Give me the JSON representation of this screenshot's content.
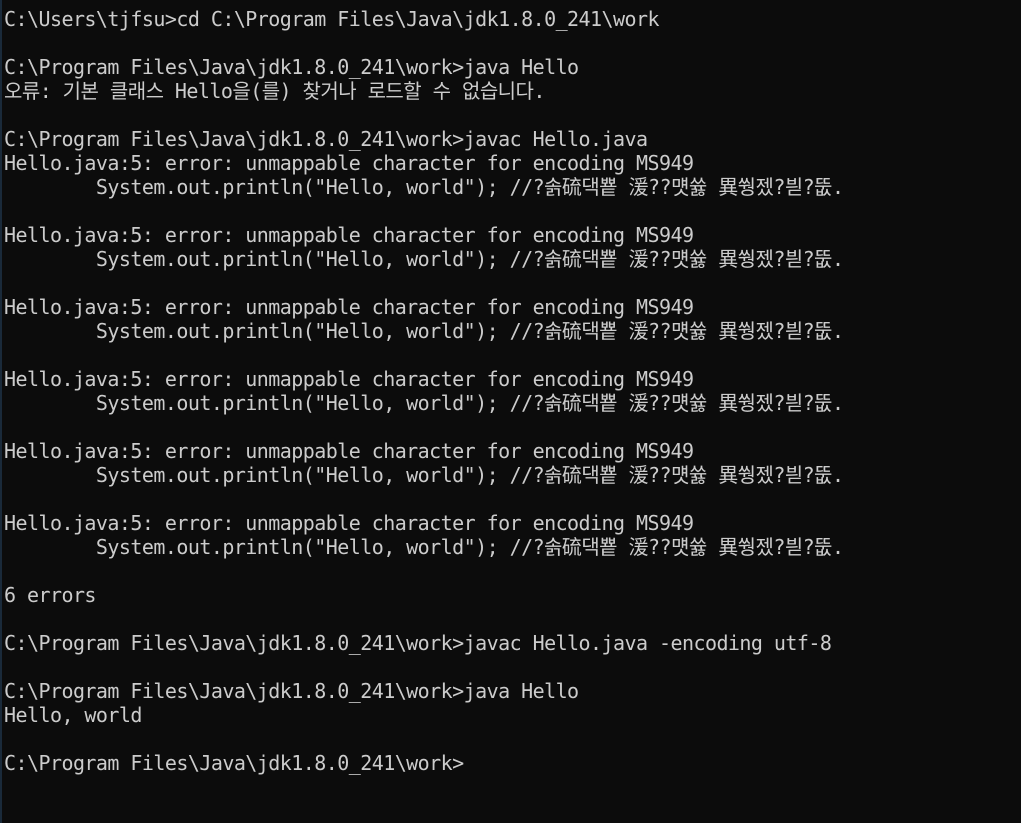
{
  "console": {
    "lines": [
      "C:\\Users\\tjfsu>cd C:\\Program Files\\Java\\jdk1.8.0_241\\work",
      "",
      "C:\\Program Files\\Java\\jdk1.8.0_241\\work>java Hello",
      "오류: 기본 클래스 Hello을(를) 찾거나 로드할 수 없습니다.",
      "",
      "C:\\Program Files\\Java\\jdk1.8.0_241\\work>javac Hello.java",
      "Hello.java:5: error: unmappable character for encoding MS949",
      "        System.out.println(\"Hello, world\"); //?솕硫댁뿉 湲??먯쓣 異쒕젰?븯?뚮.",
      "",
      "Hello.java:5: error: unmappable character for encoding MS949",
      "        System.out.println(\"Hello, world\"); //?솕硫댁뿉 湲??먯쓣 異쒕젰?븯?뚮.",
      "",
      "Hello.java:5: error: unmappable character for encoding MS949",
      "        System.out.println(\"Hello, world\"); //?솕硫댁뿉 湲??먯쓣 異쒕젰?븯?뚮.",
      "",
      "Hello.java:5: error: unmappable character for encoding MS949",
      "        System.out.println(\"Hello, world\"); //?솕硫댁뿉 湲??먯쓣 異쒕젰?븯?뚮.",
      "",
      "Hello.java:5: error: unmappable character for encoding MS949",
      "        System.out.println(\"Hello, world\"); //?솕硫댁뿉 湲??먯쓣 異쒕젰?븯?뚮.",
      "",
      "Hello.java:5: error: unmappable character for encoding MS949",
      "        System.out.println(\"Hello, world\"); //?솕硫댁뿉 湲??먯쓣 異쒕젰?븯?뚮.",
      "",
      "6 errors",
      "",
      "C:\\Program Files\\Java\\jdk1.8.0_241\\work>javac Hello.java -encoding utf-8",
      "",
      "C:\\Program Files\\Java\\jdk1.8.0_241\\work>java Hello",
      "Hello, world",
      "",
      "C:\\Program Files\\Java\\jdk1.8.0_241\\work>"
    ]
  },
  "colors": {
    "background": "#0c0c0c",
    "text": "#cccccc"
  }
}
